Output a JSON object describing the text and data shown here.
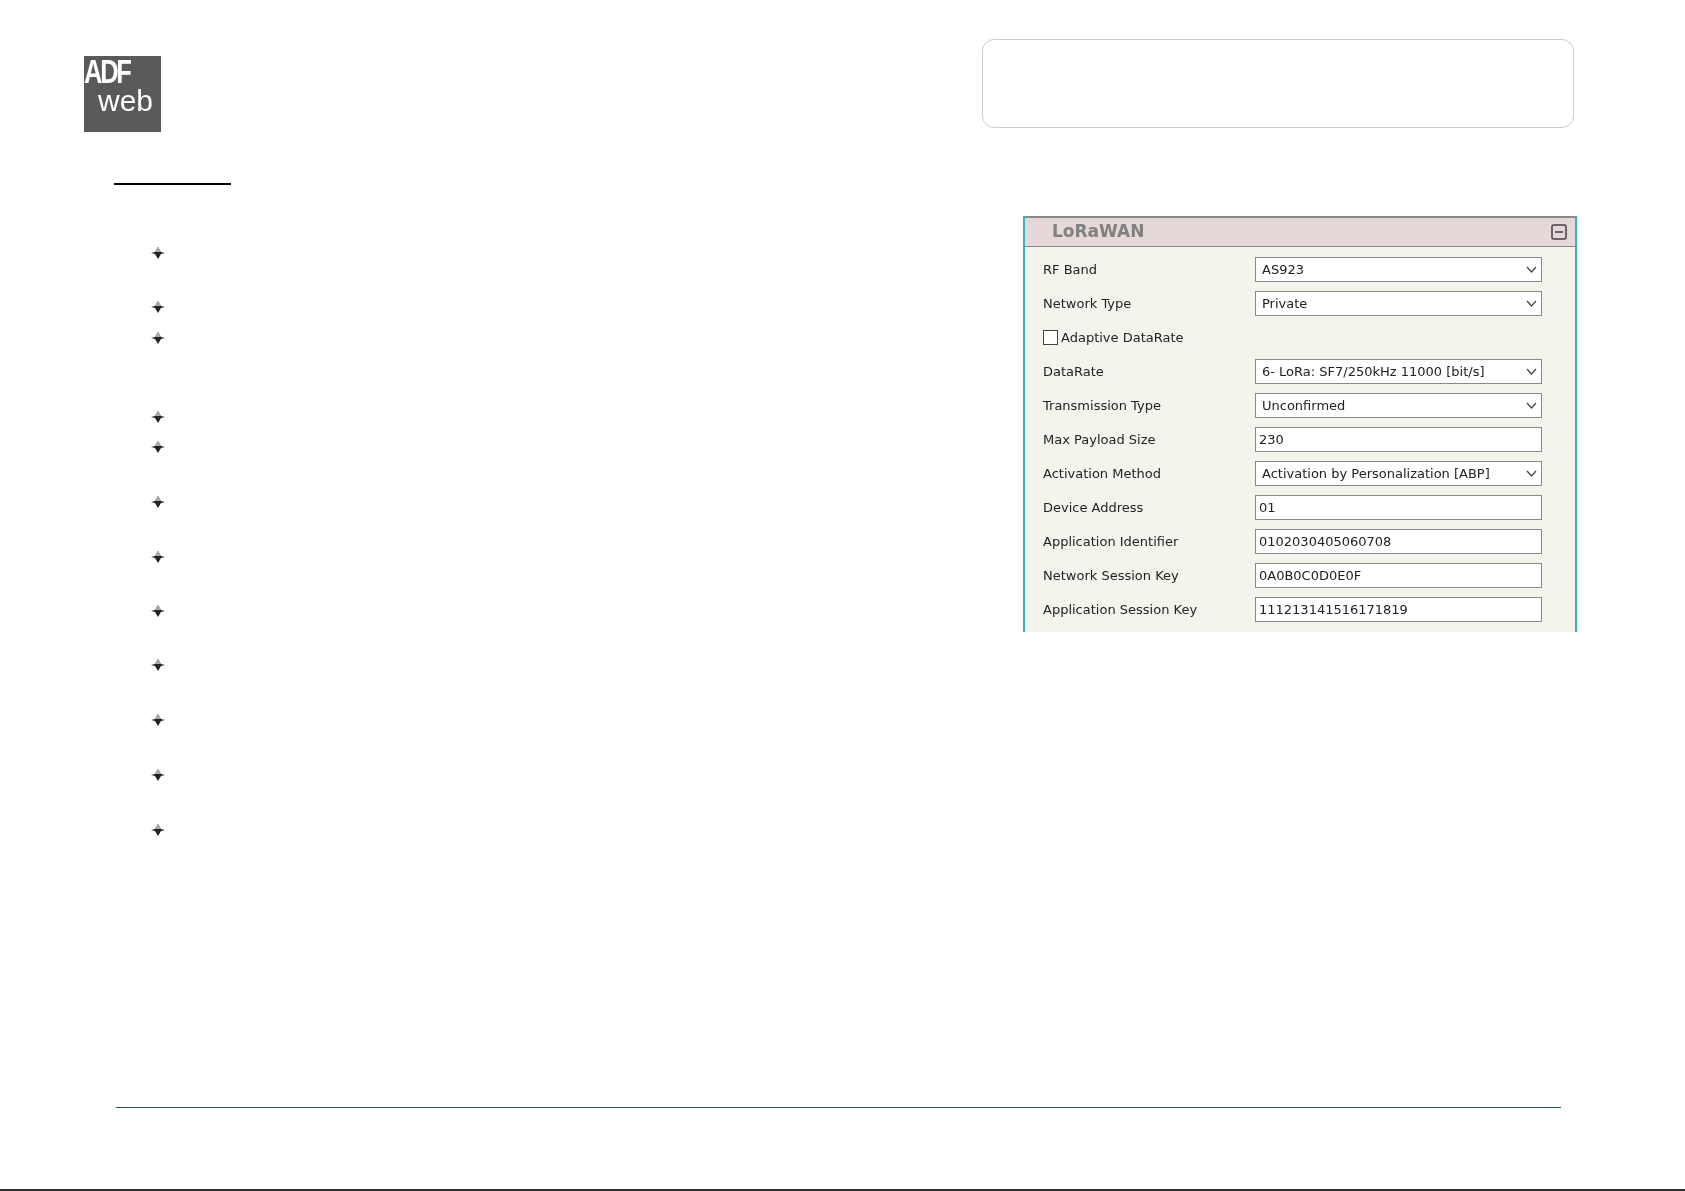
{
  "logo": {
    "line_1": "ADF",
    "line_2": "web"
  },
  "panel": {
    "title": "LoRaWAN",
    "expanded": true,
    "rows": [
      {
        "kind": "select",
        "label": "RF Band",
        "value": "AS923"
      },
      {
        "kind": "select",
        "label": "Network Type",
        "value": "Private"
      },
      {
        "kind": "checkbox",
        "label": "Adaptive DataRate",
        "checked": false
      },
      {
        "kind": "select",
        "label": "DataRate",
        "value": "6- LoRa: SF7/250kHz 11000 [bit/s]"
      },
      {
        "kind": "select",
        "label": "Transmission Type",
        "value": "Unconfirmed"
      },
      {
        "kind": "text",
        "label": "Max Payload Size",
        "value": "230"
      },
      {
        "kind": "select",
        "label": "Activation Method",
        "value": "Activation by Personalization [ABP]"
      },
      {
        "kind": "text",
        "label": "Device Address",
        "value": "01"
      },
      {
        "kind": "text",
        "label": "Application Identifier",
        "value": "0102030405060708"
      },
      {
        "kind": "text",
        "label": "Network Session Key",
        "value": "0A0B0C0D0E0F"
      },
      {
        "kind": "text",
        "label": "Application Session Key",
        "value": "111213141516171819"
      }
    ]
  }
}
